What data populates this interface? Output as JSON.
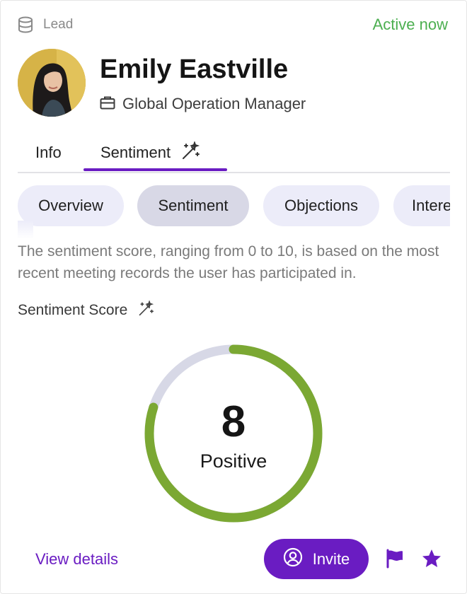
{
  "header": {
    "record_type_icon": "database-icon",
    "record_type_label": "Lead",
    "presence_status": "Active now",
    "presence_color": "#4caf50"
  },
  "profile": {
    "avatar_icon": "avatar-photo",
    "name": "Emily Eastville",
    "job_icon": "briefcase-icon",
    "job_title": "Global Operation Manager"
  },
  "tabs": [
    {
      "label": "Info",
      "active": false
    },
    {
      "label": "Sentiment",
      "active": true,
      "icon": "magic-wand-icon"
    }
  ],
  "sub_tabs": [
    {
      "label": "Overview",
      "active": false
    },
    {
      "label": "Sentiment",
      "active": true
    },
    {
      "label": "Objections",
      "active": false
    },
    {
      "label": "Intere",
      "active": false
    }
  ],
  "description": "The sentiment score, ranging from 0 to 10, is based on the most recent meeting records the user has participated in.",
  "score": {
    "label": "Sentiment Score",
    "label_icon": "magic-wand-icon",
    "value": "8",
    "max": 10,
    "sentiment": "Positive",
    "track_color": "#d7d8e6",
    "fill_color": "#7ba833"
  },
  "footer": {
    "view_details": "View details",
    "invite": "Invite",
    "invite_icon": "user-circle-icon",
    "flag_icon": "flag-icon",
    "star_icon": "star-icon"
  },
  "colors": {
    "accent": "#6a1cc2",
    "pill_bg": "#ececf9",
    "pill_active_bg": "#d8d8e6"
  }
}
